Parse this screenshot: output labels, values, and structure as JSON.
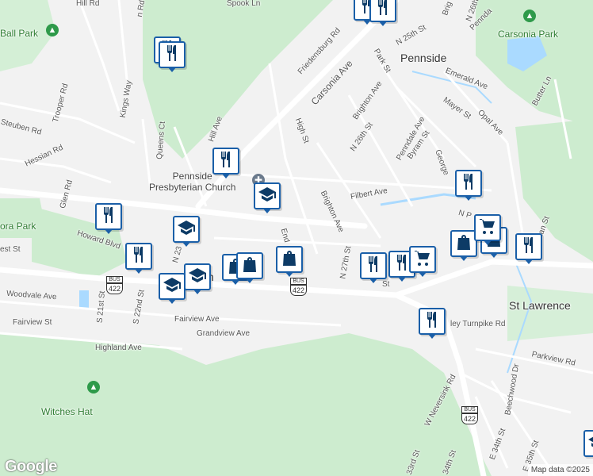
{
  "map": {
    "neighborhoods": [
      "Pennside",
      "St Lawrence"
    ],
    "parks": [
      "Ball Park",
      "Carsonia Park",
      "Witches Hat",
      "ora Park"
    ],
    "streets": [
      "Hill Rd",
      "Spook Ln",
      "Friedensburg Rd",
      "Carsonia Ave",
      "N 25th St",
      "Park St",
      "Brighton Ave",
      "Emerald Ave",
      "Penndale Ave",
      "Mayer St",
      "Opal Ave",
      "Butter Ln",
      "High St",
      "N 26th St",
      "Byram St",
      "Hill Ave",
      "Queens Ct",
      "Kings Way",
      "Trooper Rd",
      "Steuben Rd",
      "Hessian Rd",
      "Glen Rd",
      "Filbert Ave",
      "George",
      "Howard Blvd",
      "N 23",
      "Brighton Ave",
      "End",
      "N 27th St",
      "St",
      "Woodvale Ave",
      "S 21st St",
      "S 22nd St",
      "Fairview St",
      "Fairview Ave",
      "Grandview Ave",
      "Highland Ave",
      "ley Turnpike Rd",
      "Parkview Rd",
      "W Neversink Rd",
      "Beechwood Dr",
      "E 34th St",
      "E 35th St",
      "33rd St",
      "34th St",
      "rgaman St",
      "N P",
      "est St",
      "n Rd",
      "Brig",
      "N 26th",
      "Pennda",
      "n"
    ],
    "landmark": [
      "Pennside",
      "Presbyterian Church"
    ],
    "route_shield": "422",
    "route_bus": "BUS",
    "logo": "Google",
    "attribution": "Map data ©2025"
  },
  "pins": [
    {
      "type": "restaurant-icon"
    },
    {
      "type": "restaurant-icon"
    },
    {
      "type": "restaurant-icon"
    },
    {
      "type": "restaurant-icon"
    },
    {
      "type": "restaurant-icon"
    },
    {
      "type": "restaurant-icon"
    },
    {
      "type": "restaurant-icon"
    },
    {
      "type": "restaurant-icon"
    },
    {
      "type": "restaurant-icon"
    },
    {
      "type": "restaurant-icon"
    },
    {
      "type": "restaurant-icon"
    },
    {
      "type": "restaurant-icon"
    },
    {
      "type": "school-icon"
    },
    {
      "type": "school-icon"
    },
    {
      "type": "school-icon"
    },
    {
      "type": "school-icon"
    },
    {
      "type": "school-icon"
    },
    {
      "type": "shopping-bag-icon"
    },
    {
      "type": "shopping-bag-icon"
    },
    {
      "type": "shopping-bag-icon"
    },
    {
      "type": "shopping-bag-icon"
    },
    {
      "type": "shopping-bag-icon"
    },
    {
      "type": "shopping-cart-icon"
    },
    {
      "type": "shopping-cart-icon"
    }
  ],
  "colors": {
    "park": "#cdeccf",
    "water": "#aadaff",
    "road": "#ffffff",
    "pin_border": "#1a5fa8",
    "pin_icon": "#0d3b66"
  }
}
